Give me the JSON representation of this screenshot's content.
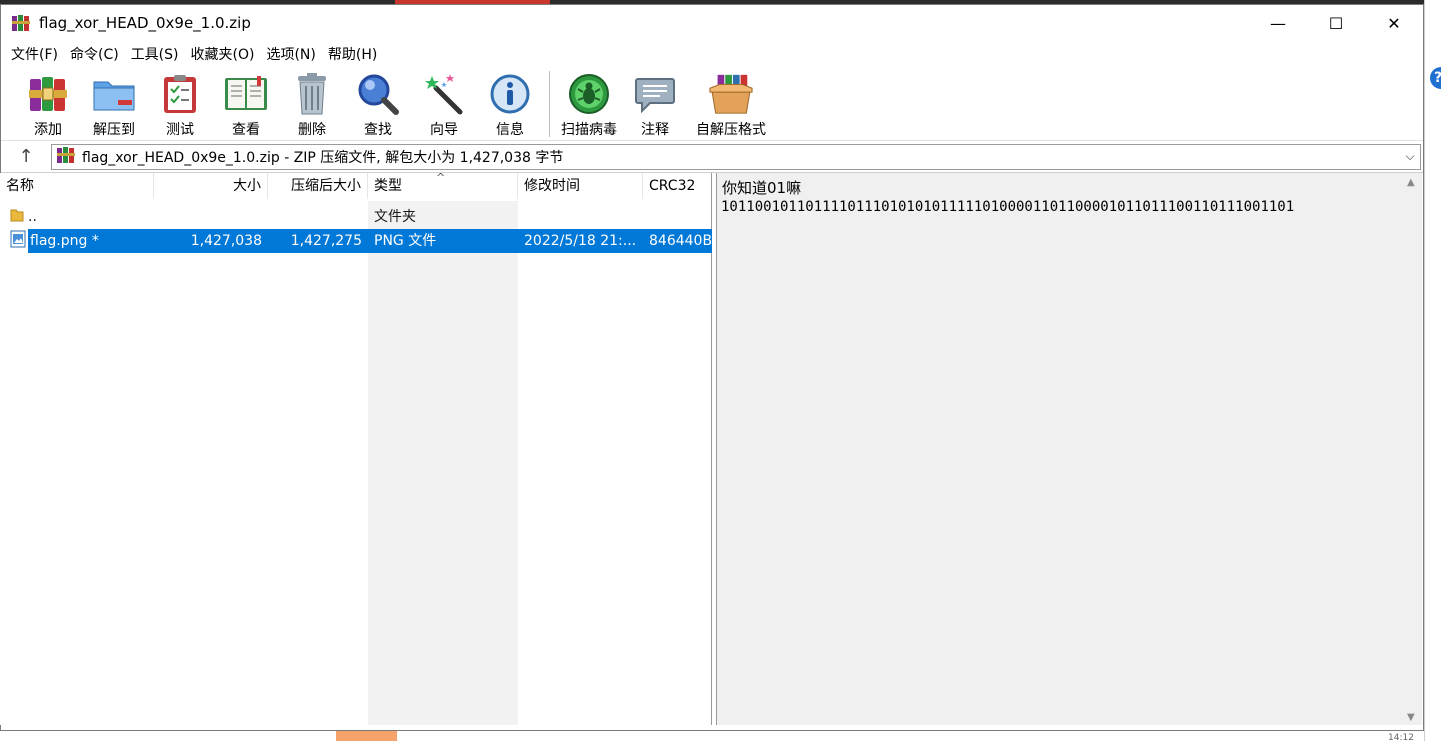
{
  "window": {
    "title": "flag_xor_HEAD_0x9e_1.0.zip",
    "minimize": "—",
    "maximize": "☐",
    "close": "✕"
  },
  "menu": [
    "文件(F)",
    "命令(C)",
    "工具(S)",
    "收藏夹(O)",
    "选项(N)",
    "帮助(H)"
  ],
  "toolbar": {
    "add": "添加",
    "extract": "解压到",
    "test": "测试",
    "view": "查看",
    "delete": "删除",
    "find": "查找",
    "wizard": "向导",
    "info": "信息",
    "scan": "扫描病毒",
    "comment": "注释",
    "sfx": "自解压格式"
  },
  "address": {
    "up": "↑",
    "path": "flag_xor_HEAD_0x9e_1.0.zip - ZIP 压缩文件, 解包大小为 1,427,038 字节",
    "dropdown": "⌵"
  },
  "columns": {
    "name": "名称",
    "size": "大小",
    "packed": "压缩后大小",
    "type": "类型",
    "modified": "修改时间",
    "crc": "CRC32",
    "sort_caret": "^"
  },
  "files": [
    {
      "name": "..",
      "size": "",
      "packed": "",
      "type": "文件夹",
      "modified": "",
      "crc": ""
    },
    {
      "name": "flag.png *",
      "size": "1,427,038",
      "packed": "1,427,275",
      "type": "PNG 文件",
      "modified": "2022/5/18 21:...",
      "crc": "846440B"
    }
  ],
  "comment": {
    "title": "你知道01嘛",
    "body": "10110010110111101110101010111110100001101100001011011100110111001101"
  },
  "background": {
    "bottom_text": "14:12",
    "help_glyph": "?"
  },
  "colors": {
    "selection": "#0078d7",
    "comment_bg": "#f0f0f0"
  }
}
